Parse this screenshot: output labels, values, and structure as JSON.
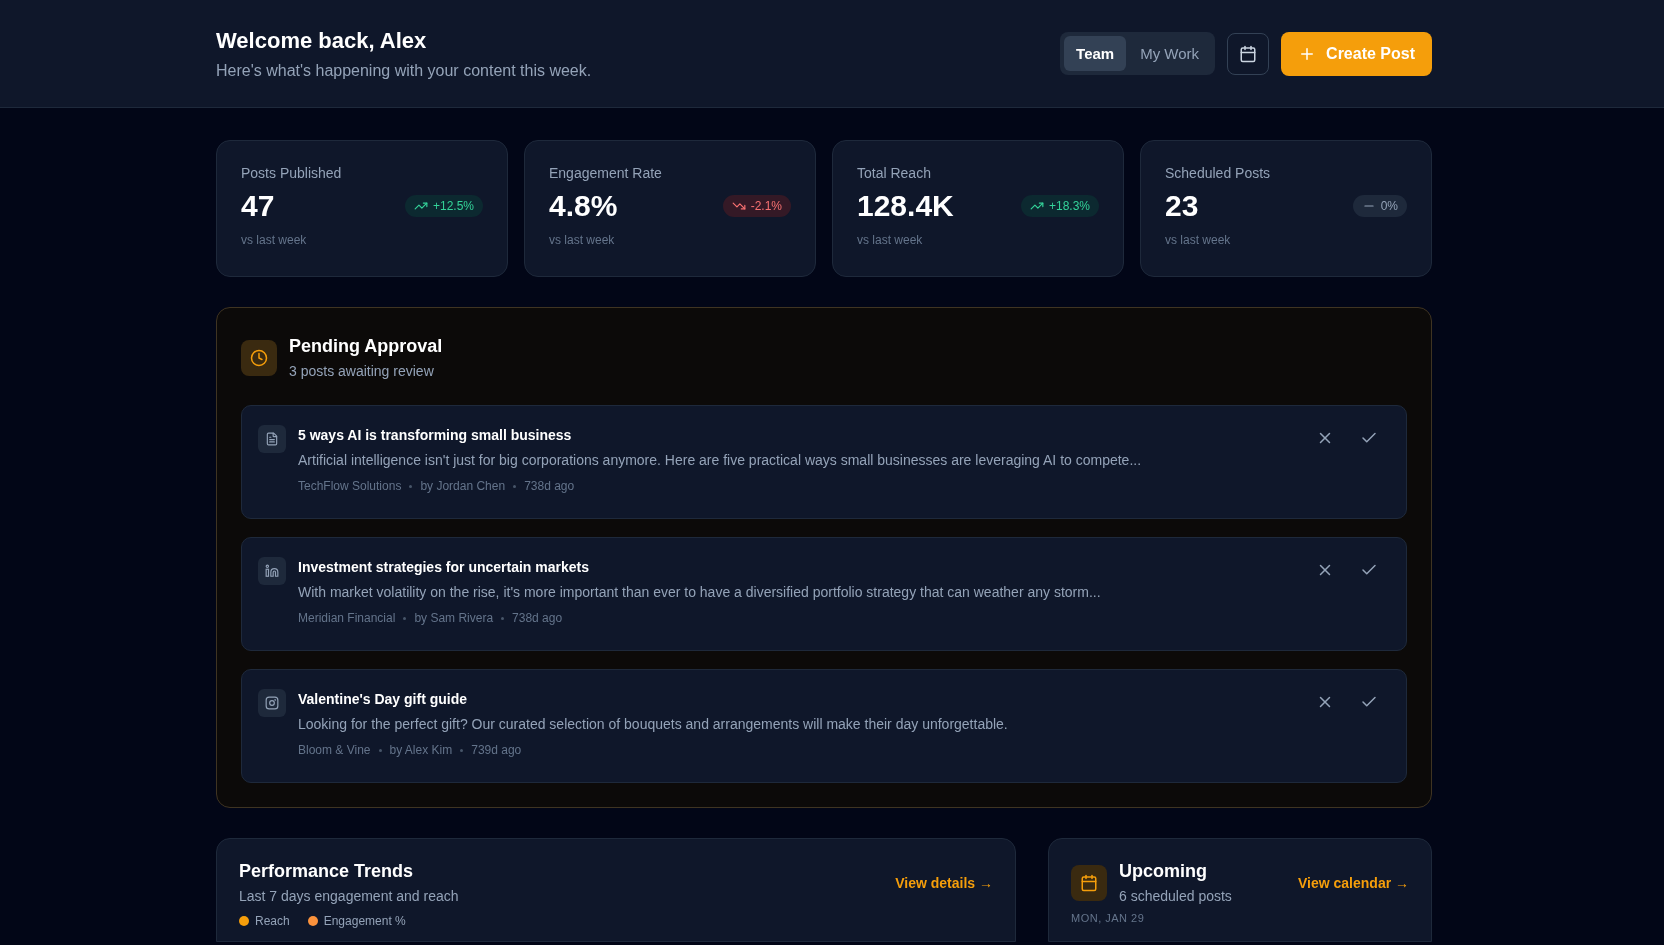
{
  "header": {
    "title": "Welcome back, Alex",
    "subtitle": "Here's what's happening with your content this week.",
    "view_toggle": [
      {
        "label": "Team",
        "selected": true
      },
      {
        "label": "My Work",
        "selected": false
      }
    ],
    "create_button": "Create Post"
  },
  "stats": [
    {
      "label": "Posts Published",
      "value": "47",
      "change": "+12.5%",
      "kind": "up",
      "note": "vs last week"
    },
    {
      "label": "Engagement Rate",
      "value": "4.8%",
      "change": "-2.1%",
      "kind": "down",
      "note": "vs last week"
    },
    {
      "label": "Total Reach",
      "value": "128.4K",
      "change": "+18.3%",
      "kind": "up",
      "note": "vs last week"
    },
    {
      "label": "Scheduled Posts",
      "value": "23",
      "change": "0%",
      "kind": "flat",
      "note": "vs last week"
    }
  ],
  "pending": {
    "title": "Pending Approval",
    "subtitle": "3 posts awaiting review",
    "posts": [
      {
        "kind": "article",
        "title": "5 ways AI is transforming small business",
        "excerpt": "Artificial intelligence isn't just for big corporations anymore. Here are five practical ways small businesses are leveraging AI to compete...",
        "client": "TechFlow Solutions",
        "author": "by Jordan Chen",
        "age": "738d ago"
      },
      {
        "kind": "linkedin",
        "title": "Investment strategies for uncertain markets",
        "excerpt": "With market volatility on the rise, it's more important than ever to have a diversified portfolio strategy that can weather any storm...",
        "client": "Meridian Financial",
        "author": "by Sam Rivera",
        "age": "738d ago"
      },
      {
        "kind": "instagram",
        "title": "Valentine's Day gift guide",
        "excerpt": "Looking for the perfect gift? Our curated selection of bouquets and arrangements will make their day unforgettable.",
        "client": "Bloom & Vine",
        "author": "by Alex Kim",
        "age": "739d ago"
      }
    ]
  },
  "performance": {
    "title": "Performance Trends",
    "subtitle": "Last 7 days engagement and reach",
    "link": "View details →",
    "legend": [
      {
        "label": "Reach",
        "color": "#f59e0b"
      },
      {
        "label": "Engagement %",
        "color": "#fb923c"
      }
    ]
  },
  "upcoming": {
    "title": "Upcoming",
    "subtitle": "6 scheduled posts",
    "link": "View calendar →",
    "day_heading": "MON, JAN 29"
  }
}
